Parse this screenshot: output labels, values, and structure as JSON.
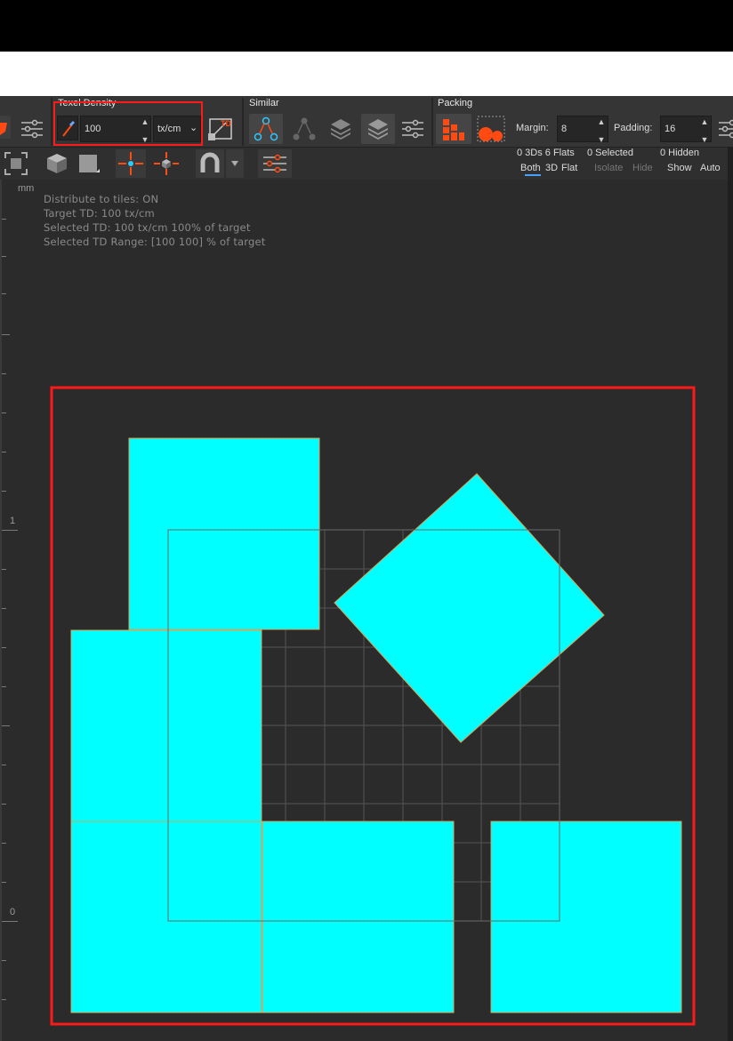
{
  "toolbar": {
    "texel_density": {
      "group_label": "Texel Density",
      "value": "100",
      "unit_options": [
        "tx/cm"
      ],
      "unit_selected": "tx/cm",
      "td_button_label": "TD"
    },
    "similar": {
      "group_label": "Similar"
    },
    "packing": {
      "group_label": "Packing",
      "margin_label": "Margin:",
      "margin_value": "8",
      "padding_label": "Padding:",
      "padding_value": "16"
    }
  },
  "toolbar2": {
    "stats": {
      "counts": "0 3Ds 6 Flats",
      "selected": "0 Selected",
      "hidden": "0 Hidden"
    },
    "filters": {
      "both": "Both",
      "three_d": "3D",
      "flat": "Flat"
    },
    "actions": {
      "isolate": "Isolate",
      "hide": "Hide",
      "show": "Show",
      "auto": "Auto"
    }
  },
  "viewport": {
    "ruler_unit": "mm",
    "ruler_labels": {
      "one": "1",
      "zero": "0"
    },
    "info_lines": [
      "Distribute to tiles: ON",
      "Target TD: 100 tx/cm",
      "Selected TD: 100 tx/cm 100% of target",
      "Selected TD Range: [100  100] % of target"
    ]
  },
  "colors": {
    "uv_fill": "#00ffff",
    "highlight_box": "#ff1a1a",
    "accent_orange": "#ff4a12",
    "panel_bg": "#2b2b2b",
    "toolbar_bg": "#353535"
  },
  "icons": [
    "shield-icon",
    "sliders-icon",
    "eyedropper-icon",
    "td-apply-icon",
    "similar-select-icon",
    "similar-dim-icon",
    "layers-icon",
    "layers-filled-icon",
    "pack-blocks-icon",
    "pack-circles-icon",
    "frame-icon",
    "cube-icon",
    "square-icon",
    "move-center-icon",
    "move-3d-icon",
    "magnet-icon",
    "dropdown-arrow-icon"
  ]
}
